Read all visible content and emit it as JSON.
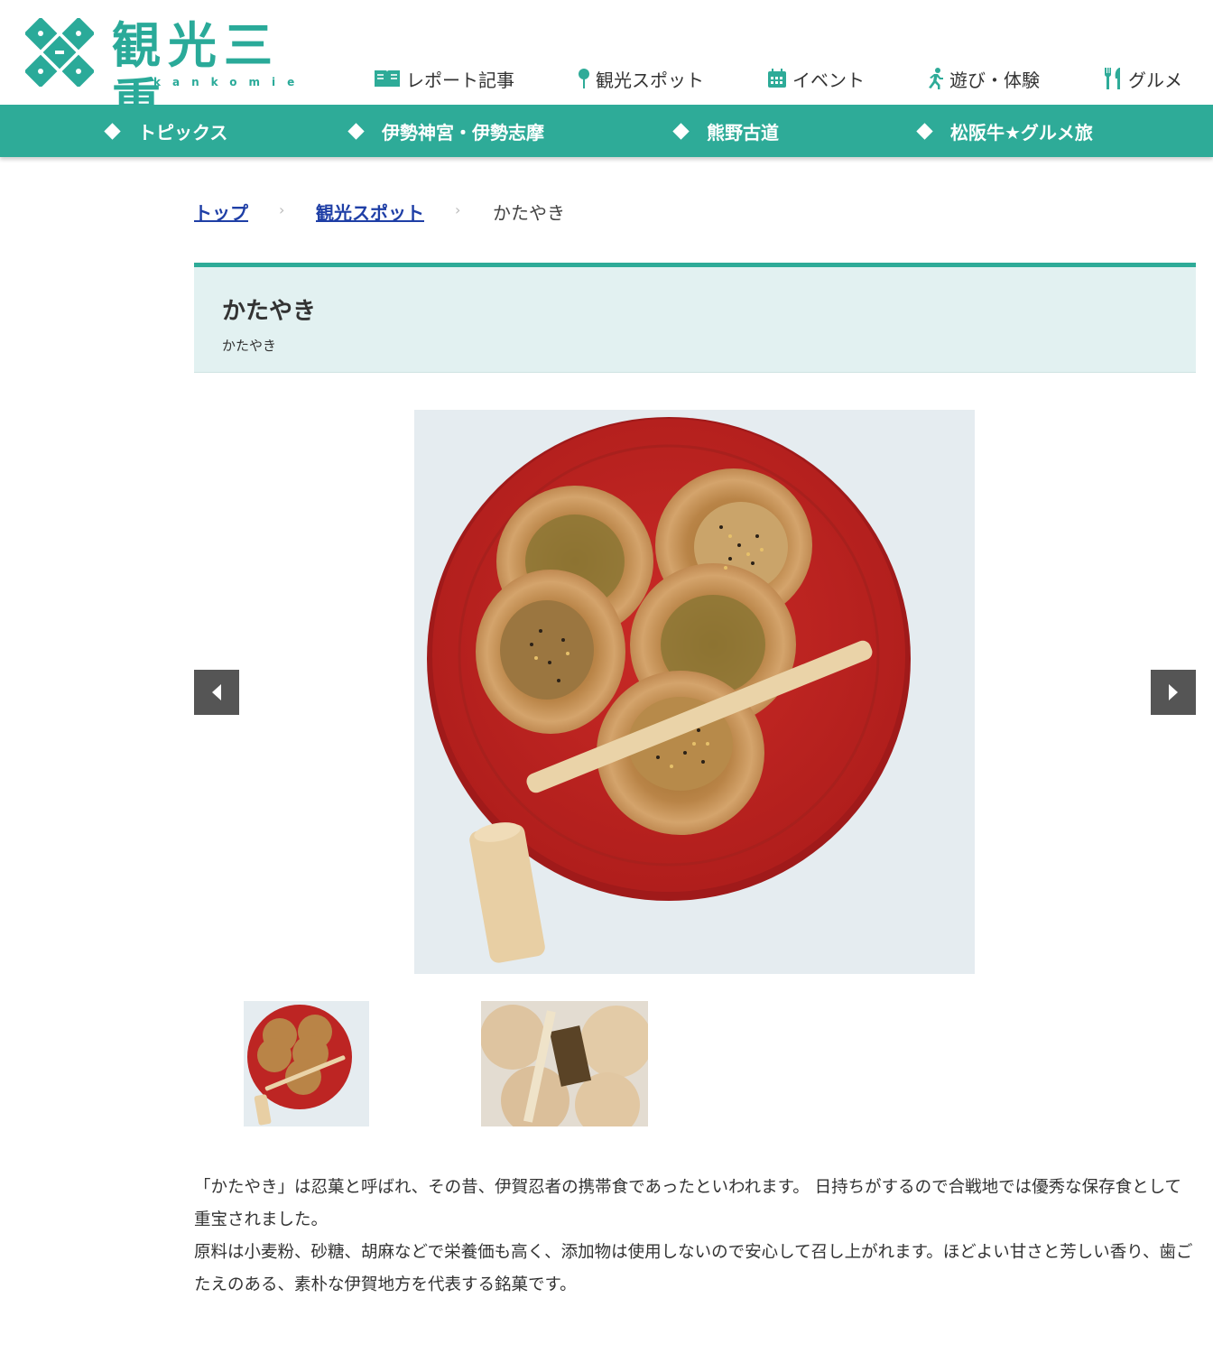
{
  "site": {
    "logo_text": "観光三重",
    "logo_sub": "kankomie",
    "brand_color": "#2eab98"
  },
  "topnav": [
    {
      "label": "レポート記事",
      "icon": "book-icon"
    },
    {
      "label": "観光スポット",
      "icon": "pin-icon"
    },
    {
      "label": "イベント",
      "icon": "calendar-icon"
    },
    {
      "label": "遊び・体験",
      "icon": "runner-icon"
    },
    {
      "label": "グルメ",
      "icon": "fork-knife-icon"
    }
  ],
  "categories": [
    "トピックス",
    "伊勢神宮・伊勢志摩",
    "熊野古道",
    "松阪牛★グルメ旅"
  ],
  "breadcrumb": {
    "home": "トップ",
    "section": "観光スポット",
    "current": "かたやき",
    "separator": "›"
  },
  "page": {
    "title": "かたやき",
    "subtitle": "かたやき"
  },
  "description": [
    "「かたやき」は忍菓と呼ばれ、その昔、伊賀忍者の携帯食であったといわれます。 日持ちがするので合戦地では優秀な保存食として重宝されました。",
    "原料は小麦粉、砂糖、胡麻などで栄養価も高く、添加物は使用しないので安心して召し上がれます。ほどよい甘さと芳しい香り、歯ごたえのある、素朴な伊賀地方を代表する銘菓です。"
  ]
}
